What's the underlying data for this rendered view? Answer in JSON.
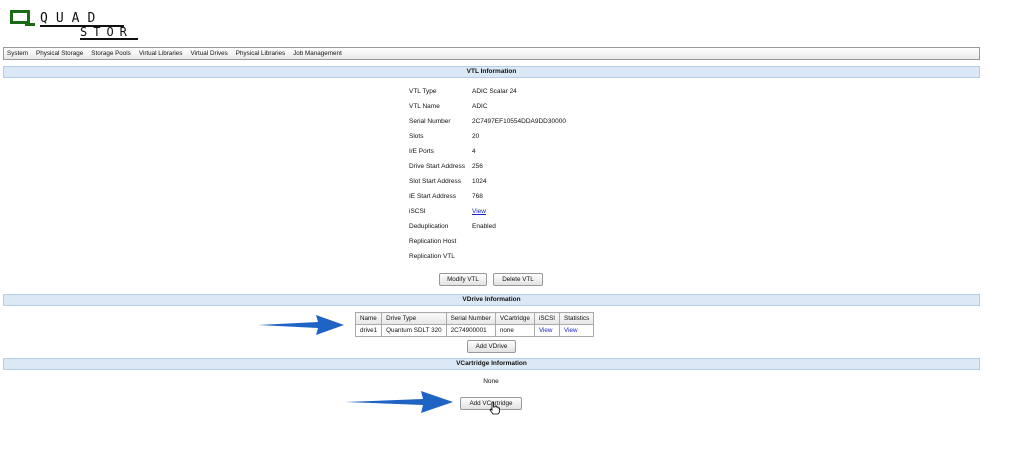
{
  "logo": {
    "top": "QUAD",
    "bottom": "STOR"
  },
  "menu": [
    "System",
    "Physical Storage",
    "Storage Pools",
    "Virtual Libraries",
    "Virtual Drives",
    "Physical Libraries",
    "Job Management"
  ],
  "vtl": {
    "title": "VTL Information",
    "props": [
      {
        "k": "VTL Type",
        "v": "ADIC Scalar 24"
      },
      {
        "k": "VTL Name",
        "v": "ADIC"
      },
      {
        "k": "Serial Number",
        "v": "2C7497EF10554DDA9DD30000"
      },
      {
        "k": "Slots",
        "v": "20"
      },
      {
        "k": "I/E Ports",
        "v": "4"
      },
      {
        "k": "Drive Start Address",
        "v": "256"
      },
      {
        "k": "Slot Start Address",
        "v": "1024"
      },
      {
        "k": "IE Start Address",
        "v": "768"
      },
      {
        "k": "iSCSI",
        "v": "View"
      },
      {
        "k": "Deduplication",
        "v": "Enabled"
      },
      {
        "k": "Replication Host",
        "v": ""
      },
      {
        "k": "Replication VTL",
        "v": ""
      }
    ],
    "modify_label": "Modify VTL",
    "delete_label": "Delete VTL"
  },
  "vdrive": {
    "title": "VDrive Information",
    "columns": [
      "Name",
      "Drive Type",
      "Serial Number",
      "VCartridge",
      "iSCSI",
      "Statistics"
    ],
    "rows": [
      [
        "drive1",
        "Quantum SDLT 320",
        "2C74900001",
        "none",
        "View",
        "View"
      ]
    ],
    "add_label": "Add VDrive"
  },
  "vcart": {
    "title": "VCartridge Information",
    "empty_text": "None",
    "add_label": "Add VCartridge"
  },
  "colors": {
    "section_bg": "#dbe8f6",
    "link": "#1a22c8",
    "arrow": "#1f63c4",
    "logo": "#1a6b14"
  }
}
